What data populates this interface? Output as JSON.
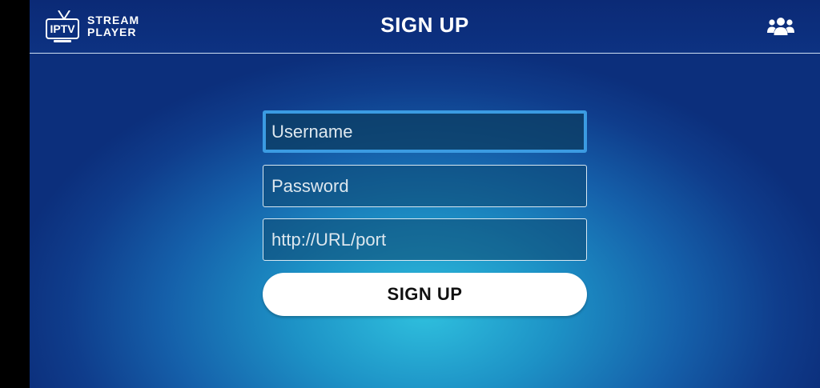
{
  "logo": {
    "badge": "IPTV",
    "line1": "STREAM",
    "line2": "PLAYER"
  },
  "header": {
    "title": "SIGN UP",
    "right_icon": "users-icon"
  },
  "form": {
    "username_placeholder": "Username",
    "password_placeholder": "Password",
    "url_placeholder": "http://URL/port",
    "submit_label": "SIGN UP"
  },
  "colors": {
    "header_bg": "#0b2a76",
    "focus_border": "#3b9be2",
    "glow_center": "#2fc0de",
    "button_bg": "#ffffff"
  }
}
